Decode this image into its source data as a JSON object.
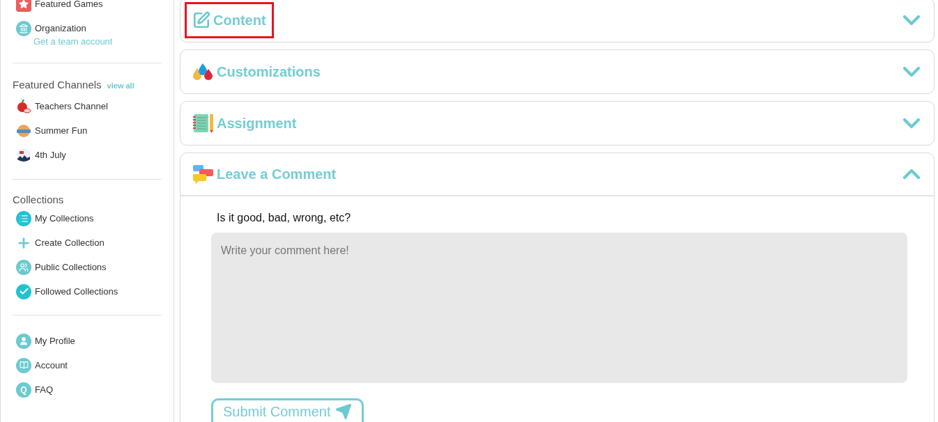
{
  "sidebar": {
    "top_items": [
      {
        "kind": "star",
        "label": "Featured Games"
      },
      {
        "kind": "building",
        "label": "Organization",
        "link": "Get a team account"
      }
    ],
    "channels": {
      "title": "Featured Channels",
      "view_all": "view all",
      "items": [
        {
          "kind": "apple",
          "label": "Teachers Channel"
        },
        {
          "kind": "sun",
          "label": "Summer Fun"
        },
        {
          "kind": "flag",
          "label": "4th July"
        }
      ]
    },
    "collections": {
      "title": "Collections",
      "items": [
        {
          "kind": "list",
          "label": "My Collections"
        },
        {
          "kind": "plus",
          "label": "Create Collection"
        },
        {
          "kind": "people",
          "label": "Public Collections"
        },
        {
          "kind": "check",
          "label": "Followed Collections"
        }
      ]
    },
    "account_items": [
      {
        "kind": "user",
        "label": "My Profile"
      },
      {
        "kind": "book",
        "label": "Account"
      },
      {
        "kind": "faq",
        "label": "FAQ",
        "icon_text": "Q"
      }
    ]
  },
  "sections": [
    {
      "kind": "edit",
      "title": "Content",
      "expanded": false,
      "highlighted": true
    },
    {
      "kind": "drops",
      "title": "Customizations",
      "expanded": false,
      "highlighted": false
    },
    {
      "kind": "notebook",
      "title": "Assignment",
      "expanded": false,
      "highlighted": false
    },
    {
      "kind": "chat",
      "title": "Leave a Comment",
      "expanded": true,
      "highlighted": false
    }
  ],
  "comment": {
    "question": "Is it good, bad, wrong, etc?",
    "placeholder": "Write your comment here!",
    "submit": "Submit Comment"
  }
}
